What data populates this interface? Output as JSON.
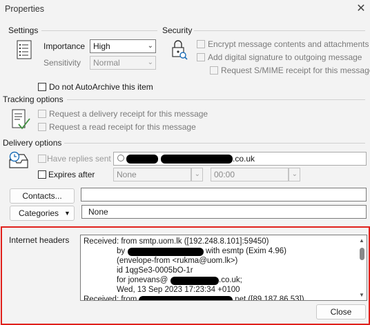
{
  "window": {
    "title": "Properties",
    "close_glyph": "✕"
  },
  "settings": {
    "heading": "Settings",
    "importance_label": "Importance",
    "importance_value": "High",
    "sensitivity_label": "Sensitivity",
    "sensitivity_value": "Normal",
    "autoarchive_label": "Do not AutoArchive this item",
    "icon": "properties-sheet-icon"
  },
  "security": {
    "heading": "Security",
    "icon": "lock-search-icon",
    "encrypt_label": "Encrypt message contents and attachments",
    "signature_label": "Add digital signature to outgoing message",
    "smime_label": "Request S/MIME receipt for this message"
  },
  "tracking": {
    "heading": "Tracking options",
    "icon": "receipt-check-icon",
    "delivery_receipt_label": "Request a delivery receipt for this message",
    "read_receipt_label": "Request a read receipt for this message"
  },
  "delivery": {
    "heading": "Delivery options",
    "icon": "inbox-clock-icon",
    "replies_label": "Have replies sent to",
    "replies_value_suffix": ".co.uk",
    "expires_label": "Expires after",
    "expires_date": "None",
    "expires_time": "00:00"
  },
  "contacts": {
    "button_label": "Contacts...",
    "value": ""
  },
  "categories": {
    "button_label": "Categories",
    "value": "None"
  },
  "internet_headers": {
    "label": "Internet headers",
    "lines": [
      "Received: from smtp.uom.lk ([192.248.8.101]:59450)",
      "with esmtp (Exim 4.96)",
      "(envelope-from <rukma@uom.lk>)",
      "id 1qgSe3-0005bO-1r",
      "for jonevans@",
      ".co.uk;",
      "Wed, 13 Sep 2023 17:23:34 +0100",
      "Received: from",
      ".net ([89.187.86.53])"
    ],
    "by_prefix": "by"
  },
  "footer": {
    "close_label": "Close"
  },
  "colors": {
    "highlight_border": "#e0201b",
    "background": "#f3f3f3"
  }
}
